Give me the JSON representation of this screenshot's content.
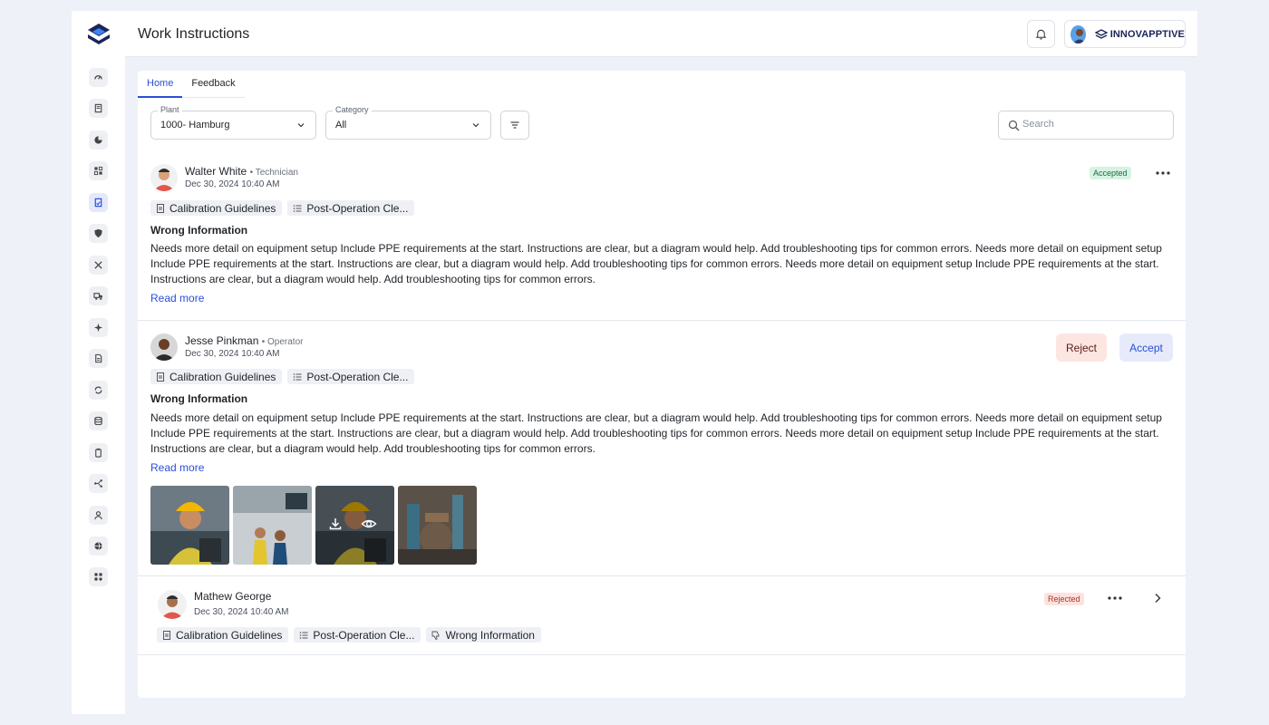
{
  "header": {
    "title": "Work Instructions",
    "brand": "INNOVAPPTIVE"
  },
  "sidebar": {
    "icons": [
      "gauge-icon",
      "document-icon",
      "pie-chart-icon",
      "grid-icon",
      "work-instructions-icon",
      "shield-icon",
      "tools-icon",
      "truck-icon",
      "sparkle-icon",
      "file-icon",
      "refresh-icon",
      "database-icon",
      "clipboard-icon",
      "flow-icon",
      "user-icon",
      "globe-icon",
      "apps-icon"
    ],
    "active_index": 4
  },
  "tabs": [
    {
      "label": "Home",
      "active": true
    },
    {
      "label": "Feedback",
      "active": false
    }
  ],
  "filters": {
    "plant": {
      "label": "Plant",
      "value": "1000- Hamburg"
    },
    "category": {
      "label": "Category",
      "value": "All"
    },
    "search_placeholder": "Search"
  },
  "entries": [
    {
      "name": "Walter White",
      "role": "Technician",
      "date": "Dec 30, 2024  10:40 AM",
      "chips": [
        "Calibration Guidelines",
        "Post-Operation Cle..."
      ],
      "title": "Wrong Information",
      "body": "Needs more detail on equipment setup Include PPE requirements at the start. Instructions are clear, but a diagram would help. Add troubleshooting tips for common errors. Needs more detail on equipment setup Include PPE requirements at the start. Instructions are clear, but a diagram would help. Add troubleshooting tips for common errors. Needs more detail on equipment setup Include PPE requirements at the start. Instructions are clear, but a diagram would help. Add troubleshooting tips for common errors.",
      "read_more": "Read more",
      "status": "Accepted"
    },
    {
      "name": "Jesse Pinkman",
      "role": "Operator",
      "date": "Dec 30, 2024  10:40 AM",
      "chips": [
        "Calibration Guidelines",
        "Post-Operation Cle..."
      ],
      "title": "Wrong Information",
      "body": "Needs more detail on equipment setup Include PPE requirements at the start. Instructions are clear, but a diagram would help. Add troubleshooting tips for common errors. Needs more detail on equipment setup Include PPE requirements at the start. Instructions are clear, but a diagram would help. Add troubleshooting tips for common errors. Needs more detail on equipment setup Include PPE requirements at the start. Instructions are clear, but a diagram would help. Add troubleshooting tips for common errors.",
      "read_more": "Read more",
      "reject_label": "Reject",
      "accept_label": "Accept",
      "attachments": [
        "worker-helmet-photo",
        "factory-workers-photo",
        "worker-helmet-photo",
        "machinery-photo"
      ]
    },
    {
      "name": "Mathew George",
      "date": "Dec 30, 2024  10:40 AM",
      "chips": [
        "Calibration Guidelines",
        "Post-Operation Cle...",
        "Wrong Information"
      ],
      "status": "Rejected"
    }
  ],
  "colors": {
    "accent": "#2b4fd8",
    "accepted_bg": "#d7f3e3",
    "rejected_bg": "#fde2de"
  }
}
